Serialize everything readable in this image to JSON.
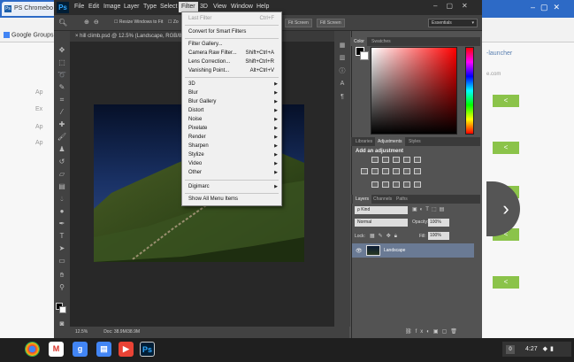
{
  "chrome": {
    "tab_title": "PS Chromebo",
    "bookmark": "Google Groups",
    "bg_right_text": "-launcher",
    "bg_right_url": "e.com",
    "bg_left_lines": [
      "Ap",
      "Ex",
      "Ap",
      "Ap"
    ],
    "arrow": "›"
  },
  "ps": {
    "logo": "Ps",
    "menus": [
      "File",
      "Edit",
      "Image",
      "Layer",
      "Type",
      "Select",
      "Filter",
      "3D",
      "View",
      "Window",
      "Help"
    ],
    "options": {
      "resize": "Resize Windows to Fit",
      "zoom": "Zo",
      "fit_screen": "Fit Screen",
      "fill_screen": "Fill Screen",
      "workspace": "Essentials"
    },
    "doc_tab": "× hill climb.psd @ 12.5% (Landscape, RGB/8)",
    "status_zoom": "12.5%",
    "status_doc": "Doc: 38.9M/38.9M"
  },
  "filter_menu": {
    "items": [
      {
        "label": "Last Filter",
        "shortcut": "Ctrl+F",
        "disabled": true
      },
      {
        "label": "Convert for Smart Filters"
      },
      {
        "label": "Filter Gallery..."
      },
      {
        "label": "Camera Raw Filter...",
        "shortcut": "Shift+Ctrl+A"
      },
      {
        "label": "Lens Correction...",
        "shortcut": "Shift+Ctrl+R"
      },
      {
        "label": "Vanishing Point...",
        "shortcut": "Alt+Ctrl+V"
      },
      {
        "label": "3D",
        "submenu": true
      },
      {
        "label": "Blur",
        "submenu": true
      },
      {
        "label": "Blur Gallery",
        "submenu": true
      },
      {
        "label": "Distort",
        "submenu": true
      },
      {
        "label": "Noise",
        "submenu": true
      },
      {
        "label": "Pixelate",
        "submenu": true
      },
      {
        "label": "Render",
        "submenu": true
      },
      {
        "label": "Sharpen",
        "submenu": true
      },
      {
        "label": "Stylize",
        "submenu": true
      },
      {
        "label": "Video",
        "submenu": true
      },
      {
        "label": "Other",
        "submenu": true
      },
      {
        "label": "Digimarc",
        "submenu": true
      },
      {
        "label": "Show All Menu Items"
      }
    ]
  },
  "panels": {
    "color_tabs": [
      "Color",
      "Swatches"
    ],
    "adj_tabs": [
      "Libraries",
      "Adjustments",
      "Styles"
    ],
    "adj_title": "Add an adjustment",
    "layers_tabs": [
      "Layers",
      "Channels",
      "Paths"
    ],
    "kind": "ρ Kind",
    "blend": "Normal",
    "opacity_label": "Opacity:",
    "opacity": "100%",
    "lock_label": "Lock:",
    "fill_label": "Fill:",
    "fill": "100%",
    "layer_name": "Landscape"
  },
  "taskbar": {
    "badge": "0",
    "time": "4:27"
  }
}
